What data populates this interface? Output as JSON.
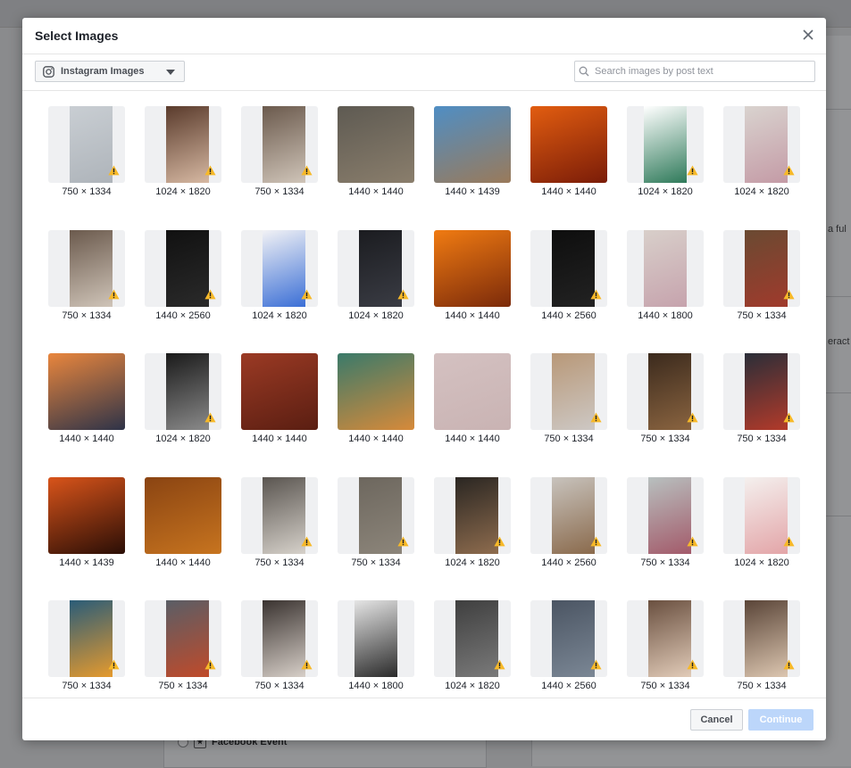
{
  "background": {
    "snippets": [
      "a ful",
      "eract"
    ],
    "event_label": "Facebook Event"
  },
  "modal": {
    "title": "Select Images",
    "source_label": "Instagram Images",
    "search_placeholder": "Search images by post text",
    "cancel_label": "Cancel",
    "continue_label": "Continue"
  },
  "colors": {
    "primary_disabled": "#bcd6fa",
    "warning": "#f7b928",
    "border": "#ccd0d5"
  },
  "images": [
    {
      "dims": "750 × 1334",
      "shape": "portrait",
      "color": "#c9ced3",
      "color2": "#aeb4ba",
      "warning": true
    },
    {
      "dims": "1024 × 1820",
      "shape": "portrait",
      "color": "#5a3b2c",
      "color2": "#d6b8a2",
      "warning": true
    },
    {
      "dims": "750 × 1334",
      "shape": "portrait",
      "color": "#6b5a4d",
      "color2": "#cfc4b8",
      "warning": true
    },
    {
      "dims": "1440 × 1440",
      "shape": "full",
      "color": "#5e5a52",
      "color2": "#8a7e6c",
      "warning": false
    },
    {
      "dims": "1440 × 1439",
      "shape": "full",
      "color": "#4f8ec4",
      "color2": "#9a7a5a",
      "warning": false
    },
    {
      "dims": "1440 × 1440",
      "shape": "full",
      "color": "#e25d10",
      "color2": "#7a1c08",
      "warning": false
    },
    {
      "dims": "1024 × 1820",
      "shape": "tall",
      "color": "#ffffff",
      "color2": "#2f7a5a",
      "warning": true
    },
    {
      "dims": "1024 × 1820",
      "shape": "portrait",
      "color": "#d9d3cf",
      "color2": "#c49ba6",
      "warning": true
    },
    {
      "dims": "750 × 1334",
      "shape": "portrait",
      "color": "#6b5a4d",
      "color2": "#cfc4b8",
      "warning": true
    },
    {
      "dims": "1440 × 2560",
      "shape": "portrait",
      "color": "#111111",
      "color2": "#2a2a2a",
      "warning": true
    },
    {
      "dims": "1024 × 1820",
      "shape": "portrait",
      "color": "#f2f2f5",
      "color2": "#3b6fd6",
      "warning": true
    },
    {
      "dims": "1024 × 1820",
      "shape": "portrait",
      "color": "#1b1c20",
      "color2": "#3a3c44",
      "warning": true
    },
    {
      "dims": "1440 × 1440",
      "shape": "full",
      "color": "#f07b12",
      "color2": "#7b2a0a",
      "warning": false
    },
    {
      "dims": "1440 × 2560",
      "shape": "portrait",
      "color": "#0e0e0e",
      "color2": "#222222",
      "warning": true
    },
    {
      "dims": "1440 × 1800",
      "shape": "tall",
      "color": "#d8cfca",
      "color2": "#c6a3ad",
      "warning": false
    },
    {
      "dims": "750 × 1334",
      "shape": "portrait",
      "color": "#6a4a32",
      "color2": "#a03a2c",
      "warning": true
    },
    {
      "dims": "1440 × 1440",
      "shape": "full",
      "color": "#e9863d",
      "color2": "#2e3348",
      "warning": false
    },
    {
      "dims": "1024 × 1820",
      "shape": "portrait",
      "color": "#1a1a1a",
      "color2": "#8a8a8a",
      "warning": true
    },
    {
      "dims": "1440 × 1440",
      "shape": "full",
      "color": "#9b3a24",
      "color2": "#5a1e12",
      "warning": false
    },
    {
      "dims": "1440 × 1440",
      "shape": "full",
      "color": "#3a7a6a",
      "color2": "#d78a3a",
      "warning": false
    },
    {
      "dims": "1440 × 1440",
      "shape": "full",
      "color": "#d4c1c1",
      "color2": "#c9b3b3",
      "warning": false
    },
    {
      "dims": "750 × 1334",
      "shape": "portrait",
      "color": "#b89878",
      "color2": "#cdc8c4",
      "warning": true
    },
    {
      "dims": "750 × 1334",
      "shape": "portrait",
      "color": "#3b2a1d",
      "color2": "#8a6440",
      "warning": true
    },
    {
      "dims": "750 × 1334",
      "shape": "portrait",
      "color": "#2a2e38",
      "color2": "#b33a2a",
      "warning": true
    },
    {
      "dims": "1440 × 1439",
      "shape": "full",
      "color": "#d9541a",
      "color2": "#2a0e06",
      "warning": false
    },
    {
      "dims": "1440 × 1440",
      "shape": "full",
      "color": "#8a4412",
      "color2": "#c7741f",
      "warning": false
    },
    {
      "dims": "750 × 1334",
      "shape": "portrait",
      "color": "#5a5550",
      "color2": "#d6d1ca",
      "warning": true
    },
    {
      "dims": "750 × 1334",
      "shape": "portrait",
      "color": "#6d675e",
      "color2": "#8c857a",
      "warning": true
    },
    {
      "dims": "1024 × 1820",
      "shape": "portrait",
      "color": "#2a2622",
      "color2": "#8e6c4e",
      "warning": true
    },
    {
      "dims": "1440 × 2560",
      "shape": "portrait",
      "color": "#c8c3bd",
      "color2": "#8a6a4c",
      "warning": true
    },
    {
      "dims": "750 × 1334",
      "shape": "portrait",
      "color": "#b8c0bf",
      "color2": "#a35a6a",
      "warning": true
    },
    {
      "dims": "1024 × 1820",
      "shape": "portrait",
      "color": "#f4f0ee",
      "color2": "#e3a5a8",
      "warning": true
    },
    {
      "dims": "750 × 1334",
      "shape": "portrait",
      "color": "#2a5c78",
      "color2": "#e59a2e",
      "warning": true
    },
    {
      "dims": "750 × 1334",
      "shape": "portrait",
      "color": "#5a5e66",
      "color2": "#c04a2a",
      "warning": true
    },
    {
      "dims": "750 × 1334",
      "shape": "portrait",
      "color": "#3a3330",
      "color2": "#d7cfc8",
      "warning": true
    },
    {
      "dims": "1440 × 1800",
      "shape": "tall",
      "color": "#e5e5e5",
      "color2": "#2a2a2a",
      "warning": false
    },
    {
      "dims": "1024 × 1820",
      "shape": "portrait",
      "color": "#3f3f3f",
      "color2": "#7a7a7a",
      "warning": true
    },
    {
      "dims": "1440 × 2560",
      "shape": "portrait",
      "color": "#4b5563",
      "color2": "#7b8795",
      "warning": true
    },
    {
      "dims": "750 × 1334",
      "shape": "portrait",
      "color": "#6a5040",
      "color2": "#e1cbb8",
      "warning": true
    },
    {
      "dims": "750 × 1334",
      "shape": "portrait",
      "color": "#5a4538",
      "color2": "#dcc6b0",
      "warning": true
    }
  ]
}
